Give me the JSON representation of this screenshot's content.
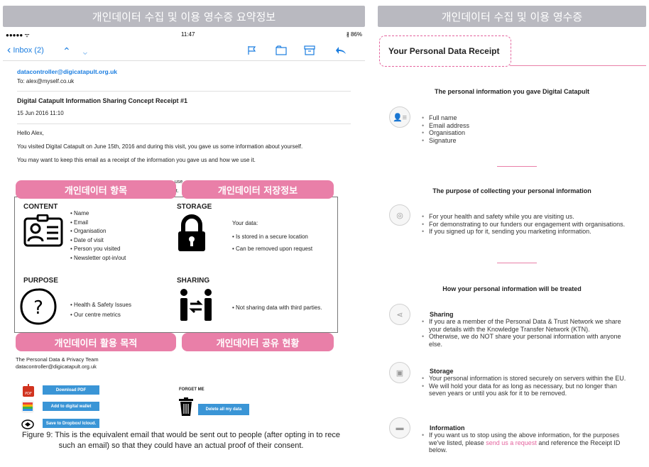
{
  "headers": {
    "left": "개인데이터 수집 및 이용 영수증 요약정보",
    "right": "개인데이터 수집 및 이용 영수증"
  },
  "phone": {
    "signal": "●●●●● ᯤ",
    "time": "11:47",
    "battery": "∦ 86%",
    "inbox_label": "Inbox (2)"
  },
  "email": {
    "from": "datacontroller@digicatapult.org.uk",
    "to": "To: alex@myself.co.uk",
    "subject": "Digital Catapult Information Sharing Concept Receipt #1",
    "date": "15 Jun 2016 11:10",
    "greeting": "Hello Alex,",
    "para1": "You visited Digital Catapult on June 15th, 2016 and during this visit, you gave us some information about yourself.",
    "para2": "You may want to keep this email as a receipt of the information you gave us and how we use it.",
    "para3_fragment": "use",
    "para3_fragment2": "pt."
  },
  "overlay_pills": {
    "items": "개인데이터 항목",
    "storage": "개인데이터 저장정보",
    "purpose": "개인데이터 활용 목적",
    "sharing": "개인데이터 공유 현황"
  },
  "card": {
    "content_title": "CONTENT",
    "content_items": [
      "Name",
      "Email",
      "Organisation",
      "Date of visit",
      "Person you visited",
      "Newsletter opt-in/out"
    ],
    "storage_title": "STORAGE",
    "storage_intro": "Your data:",
    "storage_items": [
      "Is stored in a secure location",
      "Can be removed upon request"
    ],
    "purpose_title": "PURPOSE",
    "purpose_items": [
      "Health & Safety Issues",
      "Our centre metrics"
    ],
    "sharing_title": "SHARING",
    "sharing_items": [
      "Not sharing data with third parties."
    ]
  },
  "footer": {
    "team": "The Personal Data & Privacy Team",
    "email": "datacontroller@digicatapult.org.uk",
    "download_pdf": "Download PDF",
    "add_wallet": "Add to digital wallet",
    "save_dropbox": "Save to Dropbox/ Icloud.",
    "forget_me": "FORGET ME",
    "delete_all": "Delete all my data"
  },
  "caption": {
    "line1": "Figure 9: This is the equivalent email that would be sent out to people (after opting in to rece",
    "line2": "such an email) so that they could have an actual proof of their consent."
  },
  "receipt": {
    "title": "Your Personal Data Receipt",
    "section1_heading": "The personal information you gave Digital Catapult",
    "section1_items": [
      "Full name",
      "Email address",
      "Organisation",
      "Signature"
    ],
    "section2_heading": "The purpose of collecting your personal information",
    "section2_items": [
      "For your health and safety while you are visiting us.",
      "For demonstrating to our funders our engagement with organisations.",
      "If you signed up for it, sending you marketing information."
    ],
    "section3_heading": "How your personal information will be treated",
    "sharing_title": "Sharing",
    "sharing_items": [
      "If you are a member of the Personal Data & Trust Network we share your details with the Knowledge Transfer Network (KTN).",
      "Otherwise, we do NOT share your personal information with anyone else."
    ],
    "storage_title": "Storage",
    "storage_items": [
      "Your personal information is stored securely on servers within the EU.",
      "We will hold your data for as long as necessary, but no longer than seven years or until you ask for it to be removed."
    ],
    "information_title": "Information",
    "information_pre": "If you want us to stop using the above information, for the purposes we've listed, please ",
    "information_link": "send us a request",
    "information_post": " and reference the Receipt ID below."
  },
  "colors": {
    "pink": "#e97fa8",
    "header_gray": "#b9b9c0",
    "ios_blue": "#1a7de0",
    "button_blue": "#3a95d6"
  }
}
